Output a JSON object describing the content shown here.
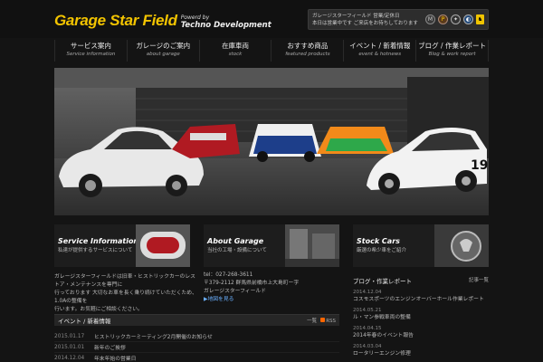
{
  "logo": {
    "main": "Garage Star Field",
    "sub1": "Powerd by",
    "sub2": "Techno Development"
  },
  "infobox": {
    "line1": "ガレージスターフィールド 営業/定休日",
    "line2": "本日は営業中です ご来店をお待ちしております",
    "brands": [
      "mazda-logo",
      "porsche-logo",
      "mercedes-logo",
      "bmw-logo",
      "ferrari-logo"
    ]
  },
  "nav": [
    {
      "jp": "サービス案内",
      "en": "Service information"
    },
    {
      "jp": "ガレージのご案内",
      "en": "about garage"
    },
    {
      "jp": "在庫車両",
      "en": "stock"
    },
    {
      "jp": "おすすめ商品",
      "en": "featured products"
    },
    {
      "jp": "イベント / 新着情報",
      "en": "event & hotnews"
    },
    {
      "jp": "ブログ / 作業レポート",
      "en": "Blog & work report"
    }
  ],
  "panels": [
    {
      "title": "Service Information",
      "sub": "私達が提供するサービスについて"
    },
    {
      "title": "About Garage",
      "sub": "当社の工場・設備について"
    },
    {
      "title": "Stock Cars",
      "sub": "厳選の希少車をご紹介"
    }
  ],
  "intro": {
    "line1": "ガレージスターフィールドは旧車・ヒストリックカーのレストア・メンテナンスを専門に",
    "line2": "行っております 大切なお車を長く乗り続けていただくため、1.0Aの整備を",
    "line3": "行います。お気軽にご相談ください。"
  },
  "contact": {
    "tel": "tel：027-268-3611",
    "address1": "〒379-2112 群馬県前橋市上大島町ー字",
    "address2": "ガレージスターフィールド",
    "map_link": "▶地図を見る"
  },
  "news": {
    "title": "イベント / 新着情報",
    "list_link": "一覧",
    "rss_label": "RSS",
    "items": [
      {
        "date": "2015.01.17",
        "title": "ヒストリックカーミーティング2月開催のお知らせ"
      },
      {
        "date": "2015.01.01",
        "title": "新年のご挨拶"
      },
      {
        "date": "2014.12.04",
        "title": "年末年始の営業日"
      }
    ]
  },
  "blog": {
    "title": "ブログ・作業レポート",
    "more": "記事一覧",
    "items": [
      {
        "date": "2014.12.04",
        "title": "コスモスポーツのエンジンオーバーホール作業レポート"
      },
      {
        "date": "2014.05.21",
        "title": "ル・マン参戦車両の整備"
      },
      {
        "date": "2014.04.15",
        "title": "2014年春のイベント報告"
      },
      {
        "date": "2014.03.04",
        "title": "ロータリーエンジン修理"
      }
    ]
  }
}
